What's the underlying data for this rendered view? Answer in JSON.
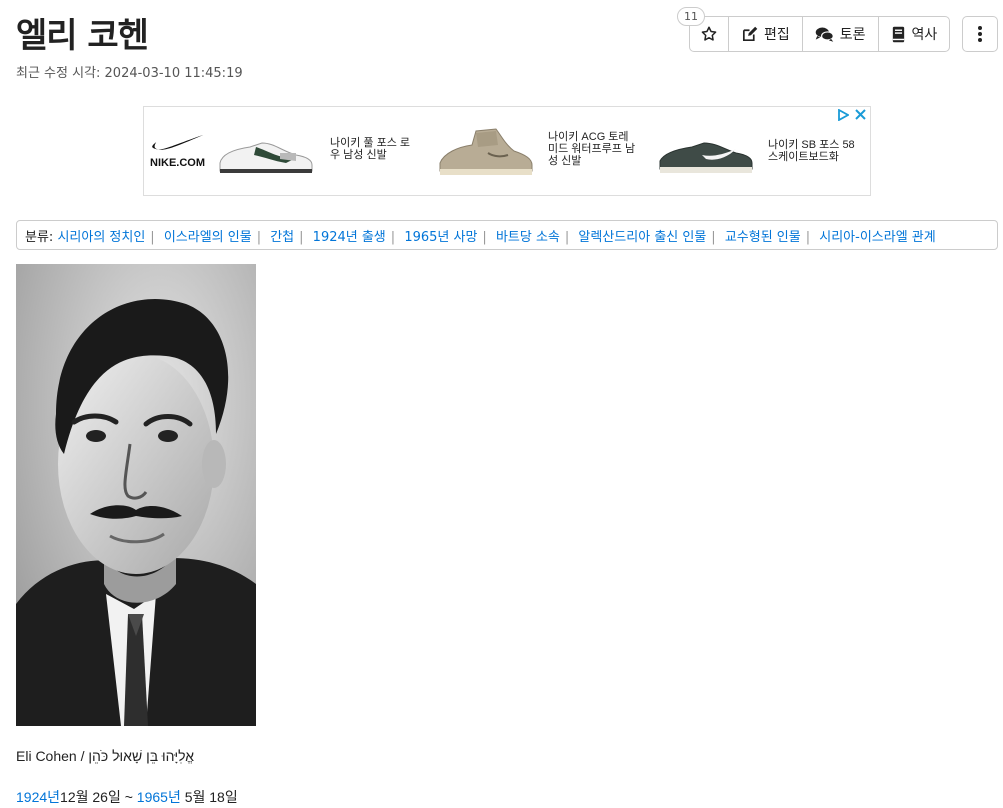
{
  "page": {
    "title": "엘리 코헨",
    "modified": "최근 수정 시각: 2024-03-10 11:45:19"
  },
  "toolbar": {
    "star_count": "11",
    "edit_label": "편집",
    "discuss_label": "토론",
    "history_label": "역사"
  },
  "ad": {
    "brand": "NIKE.COM",
    "items": [
      {
        "label": "나이키 풀 포스 로우 남성 신발",
        "icon": "white-green-sneaker"
      },
      {
        "label": "나이키 ACG 토레 미드 워터프루프 남성 신발",
        "icon": "khaki-boot"
      },
      {
        "label": "나이키 SB 포스 58 스케이트보드화",
        "icon": "dark-green-sneaker"
      }
    ]
  },
  "categories": {
    "label": "분류",
    "links": [
      "시리아의 정치인",
      "이스라엘의 인물",
      "간첩",
      "1924년 출생",
      "1965년 사망",
      "바트당 소속",
      "알렉산드리아 출신 인물",
      "교수형된 인물",
      "시리아-이스라엘 관계"
    ]
  },
  "caption": {
    "text": "Eli Cohen / אֱלִיָּהוּ בֵּן שָׁאוּל כֹּהֵן"
  },
  "dates": {
    "birth_year": "1924년",
    "birth_day": "12월 26일",
    "separator": " ~ ",
    "death_year": "1965년",
    "death_day": " 5월 18일"
  }
}
